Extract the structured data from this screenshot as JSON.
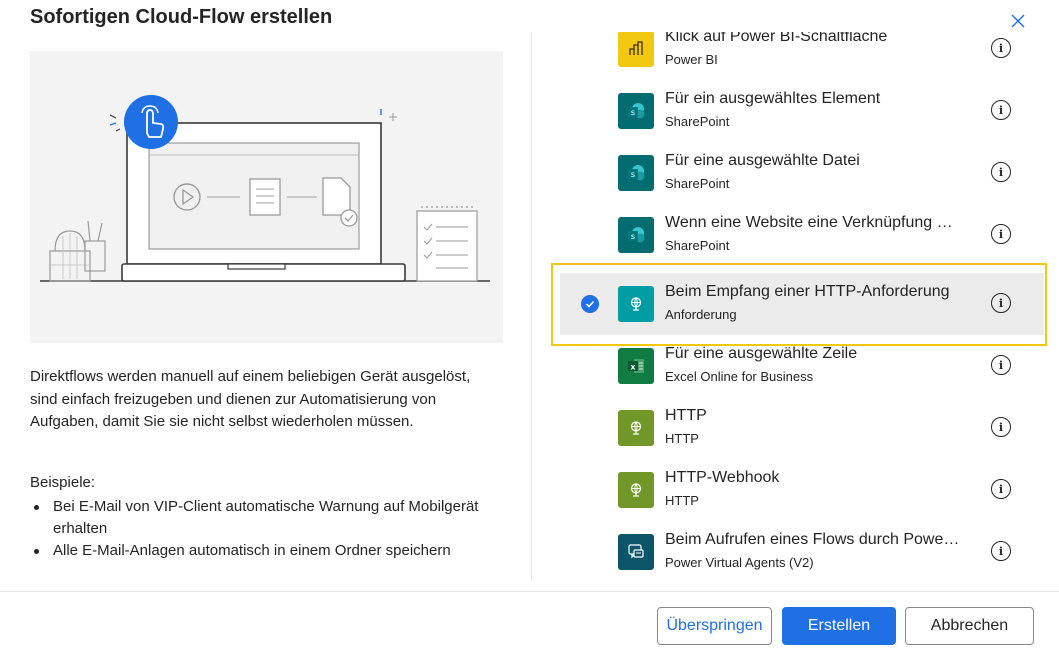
{
  "dialog": {
    "title": "Sofortigen Cloud-Flow erstellen",
    "close_icon": "close-icon"
  },
  "info": {
    "description": "Direktflows werden manuell auf einem beliebigen Gerät ausgelöst, sind einfach freizugeben und dienen zur Automatisierung von Aufgaben, damit Sie sie nicht selbst wiederholen müssen.",
    "examples_heading": "Beispiele:",
    "examples": [
      "Bei E-Mail von VIP-Client automatische Warnung auf Mobilgerät erhalten",
      "Alle E-Mail-Anlagen automatisch in einem Ordner speichern"
    ]
  },
  "triggers": [
    {
      "name": "Klick auf Power BI-Schaltfläche",
      "connector": "Power BI",
      "icon": "power-bi-icon",
      "color": "#f2c811",
      "selected": false
    },
    {
      "name": "Für ein ausgewähltes Element",
      "connector": "SharePoint",
      "icon": "sharepoint-icon",
      "color": "#036c70",
      "selected": false
    },
    {
      "name": "Für eine ausgewählte Datei",
      "connector": "SharePoint",
      "icon": "sharepoint-icon",
      "color": "#036c70",
      "selected": false
    },
    {
      "name": "Wenn eine Website eine Verknüpfung …",
      "connector": "SharePoint",
      "icon": "sharepoint-icon",
      "color": "#036c70",
      "selected": false
    },
    {
      "name": "Beim Empfang einer HTTP-Anforderung",
      "connector": "Anforderung",
      "icon": "request-globe-icon",
      "color": "#009da5",
      "selected": true
    },
    {
      "name": "Für eine ausgewählte Zeile",
      "connector": "Excel Online for Business",
      "icon": "excel-icon",
      "color": "#107c41",
      "selected": false
    },
    {
      "name": "HTTP",
      "connector": "HTTP",
      "icon": "http-globe-icon",
      "color": "#709727",
      "selected": false
    },
    {
      "name": "HTTP-Webhook",
      "connector": "HTTP",
      "icon": "http-globe-icon",
      "color": "#709727",
      "selected": false
    },
    {
      "name": "Beim Aufrufen eines Flows durch Powe…",
      "connector": "Power Virtual Agents (V2)",
      "icon": "power-virtual-agents-icon",
      "color": "#0b556a",
      "selected": false
    }
  ],
  "footer": {
    "skip_label": "Überspringen",
    "create_label": "Erstellen",
    "cancel_label": "Abbrechen"
  },
  "colors": {
    "accent": "#1f6fe5",
    "highlight": "#f2c811"
  }
}
